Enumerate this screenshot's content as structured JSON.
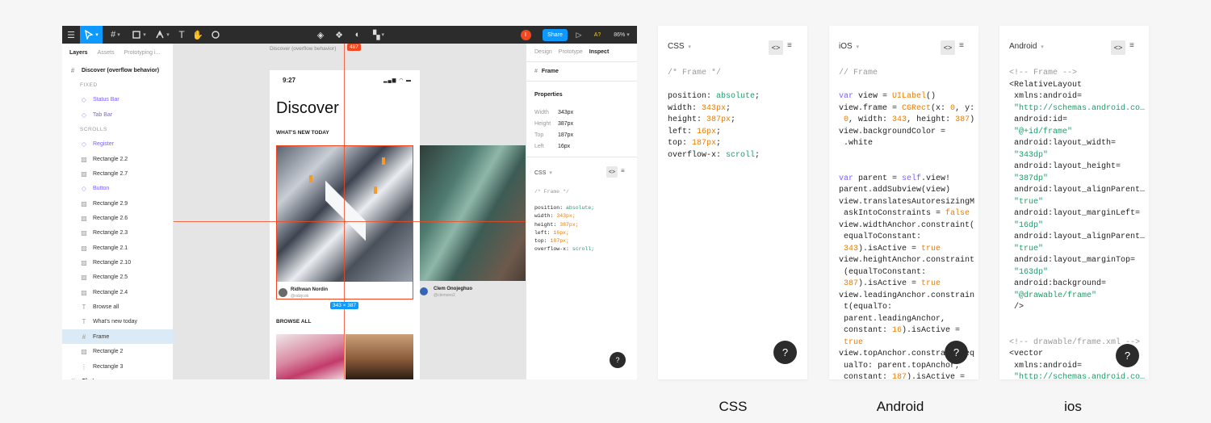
{
  "toolbar": {
    "share_label": "Share",
    "zoom": "86%",
    "avatar_initial": "I",
    "a11y": "A?"
  },
  "layers_panel": {
    "tabs": [
      "Layers",
      "Assets",
      "Prototyping i..."
    ],
    "rows": [
      {
        "label": "Discover (overflow behavior)",
        "kind": "top",
        "icon": "#"
      },
      {
        "label": "FIXED",
        "kind": "sec",
        "icon": ""
      },
      {
        "label": "Status Bar",
        "kind": "comp",
        "icon": "◇"
      },
      {
        "label": "Tab Bar",
        "kind": "comp",
        "icon": "◇"
      },
      {
        "label": "SCROLLS",
        "kind": "sec",
        "icon": ""
      },
      {
        "label": "Register",
        "kind": "comp",
        "icon": "◇"
      },
      {
        "label": "Rectangle 2.2",
        "kind": "img",
        "icon": "▨"
      },
      {
        "label": "Rectangle 2.7",
        "kind": "img",
        "icon": "▨"
      },
      {
        "label": "Button",
        "kind": "comp",
        "icon": "◇"
      },
      {
        "label": "Rectangle 2.9",
        "kind": "img",
        "icon": "▨"
      },
      {
        "label": "Rectangle 2.6",
        "kind": "img",
        "icon": "▨"
      },
      {
        "label": "Rectangle 2.3",
        "kind": "img",
        "icon": "▨"
      },
      {
        "label": "Rectangle 2.1",
        "kind": "img",
        "icon": "▨"
      },
      {
        "label": "Rectangle 2.10",
        "kind": "img",
        "icon": "▨"
      },
      {
        "label": "Rectangle 2.5",
        "kind": "img",
        "icon": "▨"
      },
      {
        "label": "Rectangle 2.4",
        "kind": "img",
        "icon": "▨"
      },
      {
        "label": "Browse all",
        "kind": "text",
        "icon": "T"
      },
      {
        "label": "What's new today",
        "kind": "text",
        "icon": "T"
      },
      {
        "label": "Frame",
        "kind": "sel",
        "icon": "#"
      },
      {
        "label": "Rectangle 2",
        "kind": "img",
        "icon": "▨"
      },
      {
        "label": "Rectangle 3",
        "kind": "img",
        "icon": "⋮"
      },
      {
        "label": "Chats",
        "kind": "top",
        "icon": "#"
      }
    ]
  },
  "canvas": {
    "frame_label": "Discover (overflow behavior)",
    "spacing_badge": "487",
    "size_badge": "343 × 387",
    "phone": {
      "time": "9:27",
      "title": "Discover",
      "section1": "WHAT'S NEW TODAY",
      "section2": "BROWSE ALL"
    },
    "card1": {
      "name": "Ridhwan Nordin",
      "handle": "@ridzjcob"
    },
    "card2": {
      "name": "Clem Onojeghuo",
      "handle": "@clemono2"
    }
  },
  "inspect_panel": {
    "tabs": [
      "Design",
      "Prototype",
      "Inspect"
    ],
    "layer_name": "Frame",
    "properties_title": "Properties",
    "props": [
      {
        "k": "Width",
        "v": "343px"
      },
      {
        "k": "Height",
        "v": "387px"
      },
      {
        "k": "Top",
        "v": "187px"
      },
      {
        "k": "Left",
        "v": "16px"
      }
    ],
    "lang": "CSS",
    "code_comment": "/* Frame */",
    "code_lines": [
      "position: absolute;",
      "width: 343px;",
      "height: 387px;",
      "left: 16px;",
      "top: 187px;",
      "overflow-x: scroll;"
    ],
    "help": "?"
  },
  "css_panel": {
    "lang": "CSS",
    "help": "?"
  },
  "ios_panel": {
    "lang": "iOS",
    "help": "?"
  },
  "android_panel": {
    "lang": "Android",
    "help": "?"
  },
  "captions": [
    "CSS",
    "Android",
    "ios"
  ],
  "colors": {
    "accent": "#0d99ff",
    "purple": "#7b61ff",
    "green": "#1a9e6a",
    "orange": "#ee7d00",
    "red": "#f24822"
  }
}
